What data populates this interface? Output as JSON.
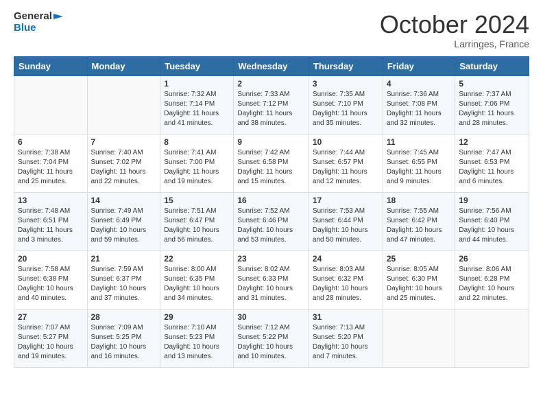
{
  "header": {
    "logo_line1": "General",
    "logo_line2": "Blue",
    "month_title": "October 2024",
    "location": "Larringes, France"
  },
  "weekdays": [
    "Sunday",
    "Monday",
    "Tuesday",
    "Wednesday",
    "Thursday",
    "Friday",
    "Saturday"
  ],
  "weeks": [
    [
      {
        "day": "",
        "sunrise": "",
        "sunset": "",
        "daylight": ""
      },
      {
        "day": "",
        "sunrise": "",
        "sunset": "",
        "daylight": ""
      },
      {
        "day": "1",
        "sunrise": "Sunrise: 7:32 AM",
        "sunset": "Sunset: 7:14 PM",
        "daylight": "Daylight: 11 hours and 41 minutes."
      },
      {
        "day": "2",
        "sunrise": "Sunrise: 7:33 AM",
        "sunset": "Sunset: 7:12 PM",
        "daylight": "Daylight: 11 hours and 38 minutes."
      },
      {
        "day": "3",
        "sunrise": "Sunrise: 7:35 AM",
        "sunset": "Sunset: 7:10 PM",
        "daylight": "Daylight: 11 hours and 35 minutes."
      },
      {
        "day": "4",
        "sunrise": "Sunrise: 7:36 AM",
        "sunset": "Sunset: 7:08 PM",
        "daylight": "Daylight: 11 hours and 32 minutes."
      },
      {
        "day": "5",
        "sunrise": "Sunrise: 7:37 AM",
        "sunset": "Sunset: 7:06 PM",
        "daylight": "Daylight: 11 hours and 28 minutes."
      }
    ],
    [
      {
        "day": "6",
        "sunrise": "Sunrise: 7:38 AM",
        "sunset": "Sunset: 7:04 PM",
        "daylight": "Daylight: 11 hours and 25 minutes."
      },
      {
        "day": "7",
        "sunrise": "Sunrise: 7:40 AM",
        "sunset": "Sunset: 7:02 PM",
        "daylight": "Daylight: 11 hours and 22 minutes."
      },
      {
        "day": "8",
        "sunrise": "Sunrise: 7:41 AM",
        "sunset": "Sunset: 7:00 PM",
        "daylight": "Daylight: 11 hours and 19 minutes."
      },
      {
        "day": "9",
        "sunrise": "Sunrise: 7:42 AM",
        "sunset": "Sunset: 6:58 PM",
        "daylight": "Daylight: 11 hours and 15 minutes."
      },
      {
        "day": "10",
        "sunrise": "Sunrise: 7:44 AM",
        "sunset": "Sunset: 6:57 PM",
        "daylight": "Daylight: 11 hours and 12 minutes."
      },
      {
        "day": "11",
        "sunrise": "Sunrise: 7:45 AM",
        "sunset": "Sunset: 6:55 PM",
        "daylight": "Daylight: 11 hours and 9 minutes."
      },
      {
        "day": "12",
        "sunrise": "Sunrise: 7:47 AM",
        "sunset": "Sunset: 6:53 PM",
        "daylight": "Daylight: 11 hours and 6 minutes."
      }
    ],
    [
      {
        "day": "13",
        "sunrise": "Sunrise: 7:48 AM",
        "sunset": "Sunset: 6:51 PM",
        "daylight": "Daylight: 11 hours and 3 minutes."
      },
      {
        "day": "14",
        "sunrise": "Sunrise: 7:49 AM",
        "sunset": "Sunset: 6:49 PM",
        "daylight": "Daylight: 10 hours and 59 minutes."
      },
      {
        "day": "15",
        "sunrise": "Sunrise: 7:51 AM",
        "sunset": "Sunset: 6:47 PM",
        "daylight": "Daylight: 10 hours and 56 minutes."
      },
      {
        "day": "16",
        "sunrise": "Sunrise: 7:52 AM",
        "sunset": "Sunset: 6:46 PM",
        "daylight": "Daylight: 10 hours and 53 minutes."
      },
      {
        "day": "17",
        "sunrise": "Sunrise: 7:53 AM",
        "sunset": "Sunset: 6:44 PM",
        "daylight": "Daylight: 10 hours and 50 minutes."
      },
      {
        "day": "18",
        "sunrise": "Sunrise: 7:55 AM",
        "sunset": "Sunset: 6:42 PM",
        "daylight": "Daylight: 10 hours and 47 minutes."
      },
      {
        "day": "19",
        "sunrise": "Sunrise: 7:56 AM",
        "sunset": "Sunset: 6:40 PM",
        "daylight": "Daylight: 10 hours and 44 minutes."
      }
    ],
    [
      {
        "day": "20",
        "sunrise": "Sunrise: 7:58 AM",
        "sunset": "Sunset: 6:38 PM",
        "daylight": "Daylight: 10 hours and 40 minutes."
      },
      {
        "day": "21",
        "sunrise": "Sunrise: 7:59 AM",
        "sunset": "Sunset: 6:37 PM",
        "daylight": "Daylight: 10 hours and 37 minutes."
      },
      {
        "day": "22",
        "sunrise": "Sunrise: 8:00 AM",
        "sunset": "Sunset: 6:35 PM",
        "daylight": "Daylight: 10 hours and 34 minutes."
      },
      {
        "day": "23",
        "sunrise": "Sunrise: 8:02 AM",
        "sunset": "Sunset: 6:33 PM",
        "daylight": "Daylight: 10 hours and 31 minutes."
      },
      {
        "day": "24",
        "sunrise": "Sunrise: 8:03 AM",
        "sunset": "Sunset: 6:32 PM",
        "daylight": "Daylight: 10 hours and 28 minutes."
      },
      {
        "day": "25",
        "sunrise": "Sunrise: 8:05 AM",
        "sunset": "Sunset: 6:30 PM",
        "daylight": "Daylight: 10 hours and 25 minutes."
      },
      {
        "day": "26",
        "sunrise": "Sunrise: 8:06 AM",
        "sunset": "Sunset: 6:28 PM",
        "daylight": "Daylight: 10 hours and 22 minutes."
      }
    ],
    [
      {
        "day": "27",
        "sunrise": "Sunrise: 7:07 AM",
        "sunset": "Sunset: 5:27 PM",
        "daylight": "Daylight: 10 hours and 19 minutes."
      },
      {
        "day": "28",
        "sunrise": "Sunrise: 7:09 AM",
        "sunset": "Sunset: 5:25 PM",
        "daylight": "Daylight: 10 hours and 16 minutes."
      },
      {
        "day": "29",
        "sunrise": "Sunrise: 7:10 AM",
        "sunset": "Sunset: 5:23 PM",
        "daylight": "Daylight: 10 hours and 13 minutes."
      },
      {
        "day": "30",
        "sunrise": "Sunrise: 7:12 AM",
        "sunset": "Sunset: 5:22 PM",
        "daylight": "Daylight: 10 hours and 10 minutes."
      },
      {
        "day": "31",
        "sunrise": "Sunrise: 7:13 AM",
        "sunset": "Sunset: 5:20 PM",
        "daylight": "Daylight: 10 hours and 7 minutes."
      },
      {
        "day": "",
        "sunrise": "",
        "sunset": "",
        "daylight": ""
      },
      {
        "day": "",
        "sunrise": "",
        "sunset": "",
        "daylight": ""
      }
    ]
  ]
}
